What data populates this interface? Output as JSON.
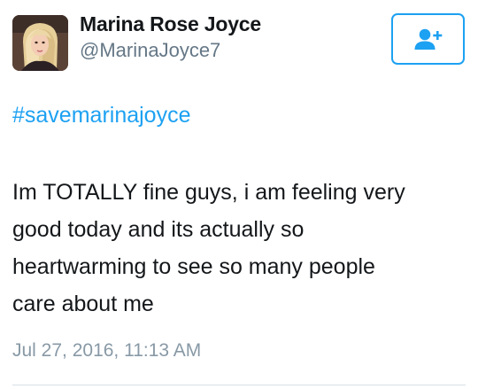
{
  "author": {
    "display_name": "Marina Rose Joyce",
    "handle": "@MarinaJoyce7",
    "avatar_icon": "profile-photo"
  },
  "follow_button": {
    "icon": "add-user-icon",
    "color": "#1da1f2"
  },
  "tweet": {
    "hashtag": "#savemarinajoyce",
    "text_lines": [
      "Im TOTALLY fine guys, i am feeling very",
      "good today and its actually so",
      "heartwarming to see so many people",
      "care about me"
    ],
    "timestamp": "Jul 27, 2016, 11:13 AM"
  },
  "colors": {
    "link": "#1da1f2",
    "text": "#14171a",
    "secondary_text": "#657786",
    "timestamp": "#8899a6"
  }
}
